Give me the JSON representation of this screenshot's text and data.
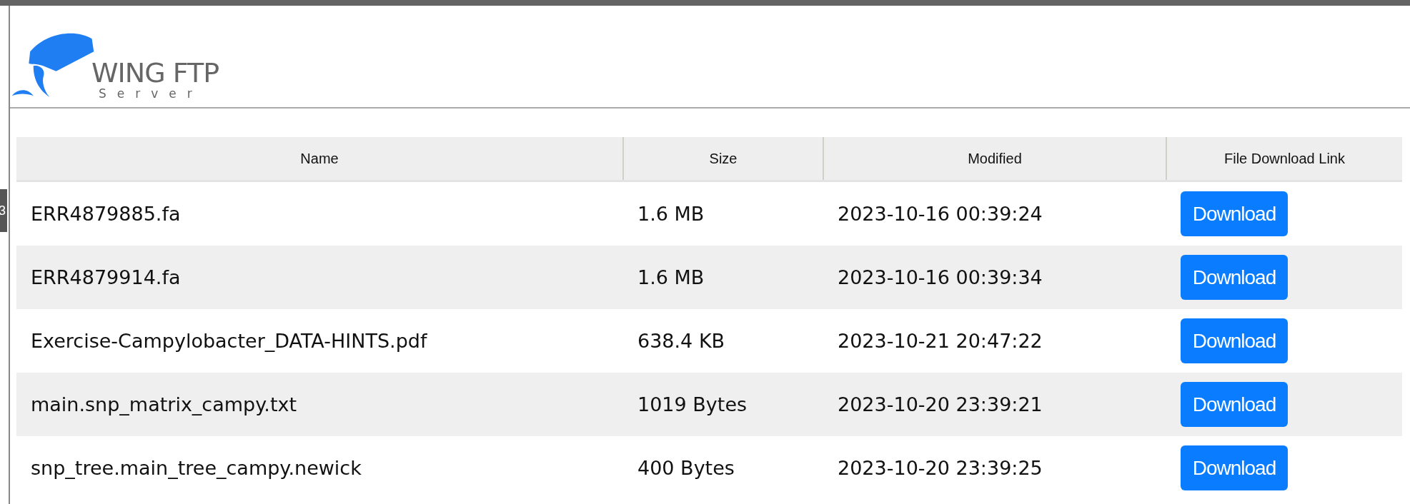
{
  "side_tab": {
    "label": "3"
  },
  "logo": {
    "title": "WING FTP",
    "subtitle": "Server"
  },
  "table": {
    "columns": [
      "Name",
      "Size",
      "Modified",
      "File Download Link"
    ],
    "rows": [
      {
        "name": "ERR4879885.fa",
        "size": "1.6 MB",
        "modified": "2023-10-16 00:39:24",
        "link": "Download"
      },
      {
        "name": "ERR4879914.fa",
        "size": "1.6 MB",
        "modified": "2023-10-16 00:39:34",
        "link": "Download"
      },
      {
        "name": "Exercise-Campylobacter_DATA-HINTS.pdf",
        "size": "638.4 KB",
        "modified": "2023-10-21 20:47:22",
        "link": "Download"
      },
      {
        "name": "main.snp_matrix_campy.txt",
        "size": "1019 Bytes",
        "modified": "2023-10-20 23:39:21",
        "link": "Download"
      },
      {
        "name": "snp_tree.main_tree_campy.newick",
        "size": "400 Bytes",
        "modified": "2023-10-20 23:39:25",
        "link": "Download"
      }
    ]
  }
}
